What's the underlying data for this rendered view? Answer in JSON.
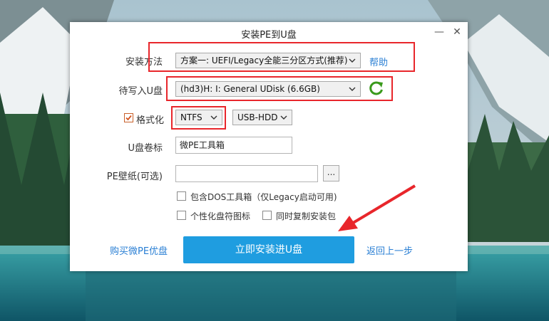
{
  "dialog": {
    "title": "安装PE到U盘",
    "minimize_label": "—",
    "close_label": "✕"
  },
  "form": {
    "install_method_label": "安装方法",
    "install_method_value": "方案一: UEFI/Legacy全能三分区方式(推荐)",
    "help_label": "帮助",
    "target_disk_label": "待写入U盘",
    "target_disk_value": "(hd3)H: I: General UDisk (6.6GB)",
    "format_label": "格式化",
    "format_checked": true,
    "filesystem_value": "NTFS",
    "mode_value": "USB-HDD",
    "volume_label_label": "U盘卷标",
    "volume_label_value": "微PE工具箱",
    "wallpaper_label": "PE壁纸(可选)",
    "wallpaper_value": "",
    "browse_label": "...",
    "option_dos_tools": "包含DOS工具箱（仅Legacy启动可用)",
    "option_dos_tools_checked": false,
    "option_personalize_icon": "个性化盘符图标",
    "option_personalize_icon_checked": false,
    "option_copy_installer": "同时复制安装包",
    "option_copy_installer_checked": false
  },
  "footer": {
    "buy_link": "购买微PE优盘",
    "install_button": "立即安装进U盘",
    "back_link": "返回上一步"
  },
  "colors": {
    "accent_blue": "#1f9de0",
    "link_blue": "#2a7fd4",
    "highlight_red": "#e8262b",
    "refresh_green": "#3a9a1c"
  }
}
